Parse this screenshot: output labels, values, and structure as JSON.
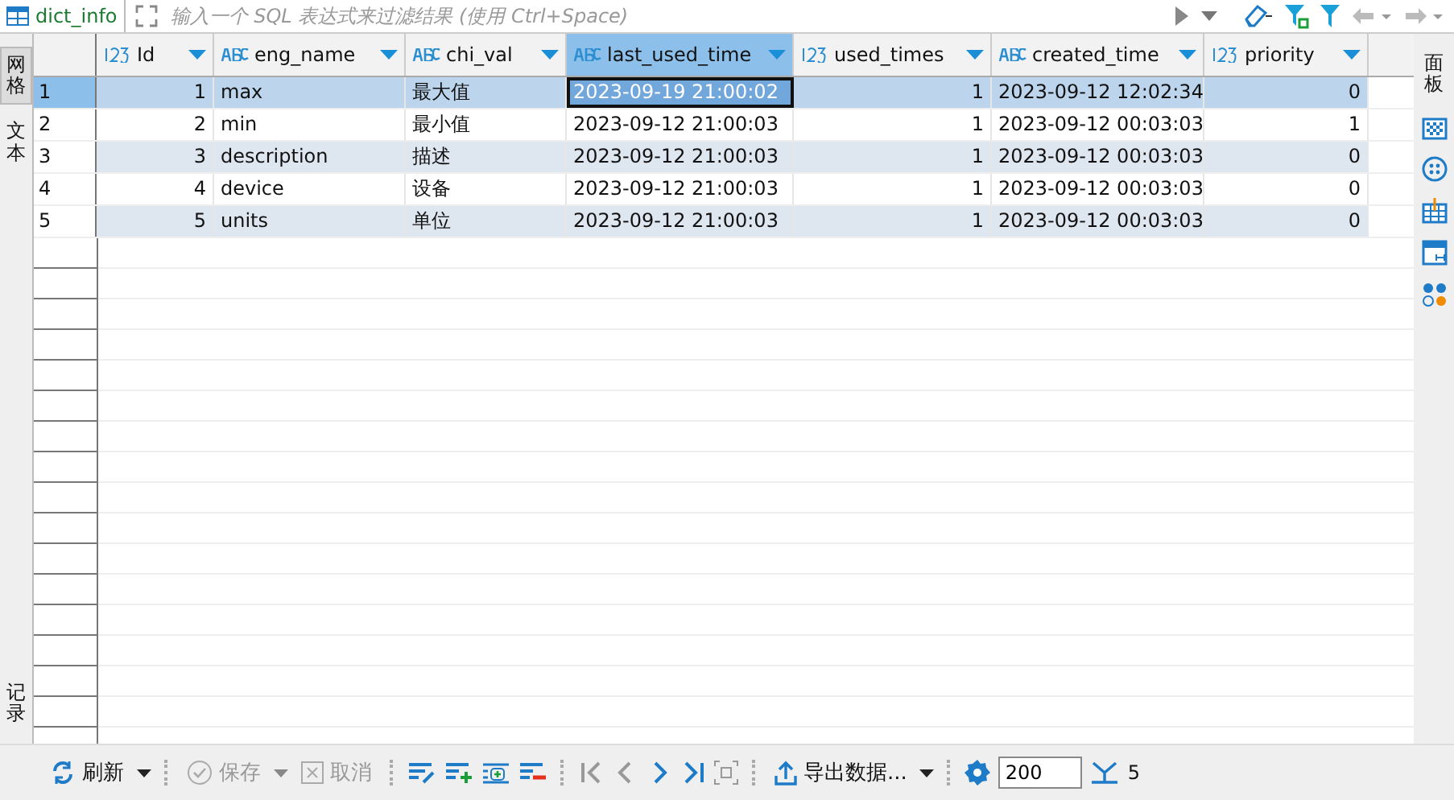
{
  "tab": {
    "title": "dict_info"
  },
  "filter": {
    "placeholder": "输入一个 SQL 表达式来过滤结果 (使用 Ctrl+Space)"
  },
  "left_panels": [
    {
      "label": "网格",
      "selected": true
    },
    {
      "label": "文本",
      "selected": false
    },
    {
      "label": "记录",
      "selected": false
    }
  ],
  "right_panels": [
    {
      "label": "面板",
      "selected": false
    }
  ],
  "table": {
    "columns": [
      {
        "name": "Id",
        "kind": "number",
        "selected": false
      },
      {
        "name": "eng_name",
        "kind": "text",
        "selected": false
      },
      {
        "name": "chi_val",
        "kind": "text",
        "selected": false
      },
      {
        "name": "last_used_time",
        "kind": "text",
        "selected": true
      },
      {
        "name": "used_times",
        "kind": "number",
        "selected": false
      },
      {
        "name": "created_time",
        "kind": "text",
        "selected": false
      },
      {
        "name": "priority",
        "kind": "number",
        "selected": false
      }
    ],
    "rows": [
      {
        "number": "1",
        "selected": true,
        "focused": true,
        "cells": [
          "1",
          "max",
          "最大值",
          "2023-09-19 21:00:02",
          "1",
          "2023-09-12 12:02:34",
          "0"
        ]
      },
      {
        "number": "2",
        "selected": false,
        "focused": false,
        "cells": [
          "2",
          "min",
          "最小值",
          "2023-09-12 21:00:03",
          "1",
          "2023-09-12 00:03:03",
          "1"
        ]
      },
      {
        "number": "3",
        "selected": false,
        "focused": false,
        "cells": [
          "3",
          "description",
          "描述",
          "2023-09-12 21:00:03",
          "1",
          "2023-09-12 00:03:03",
          "0"
        ]
      },
      {
        "number": "4",
        "selected": false,
        "focused": false,
        "cells": [
          "4",
          "device",
          "设备",
          "2023-09-12 21:00:03",
          "1",
          "2023-09-12 00:03:03",
          "0"
        ]
      },
      {
        "number": "5",
        "selected": false,
        "focused": false,
        "cells": [
          "5",
          "units",
          "单位",
          "2023-09-12 21:00:03",
          "1",
          "2023-09-12 00:03:03",
          "0"
        ]
      }
    ]
  },
  "toolbar": {
    "refresh": {
      "label": "刷新",
      "disabled": false
    },
    "save": {
      "label": "保存",
      "disabled": true
    },
    "cancel": {
      "label": "取消",
      "disabled": true
    },
    "nav": [
      {
        "kind": "first",
        "disabled": true
      },
      {
        "kind": "prev",
        "disabled": true
      },
      {
        "kind": "next",
        "disabled": false
      },
      {
        "kind": "last",
        "disabled": false
      }
    ],
    "export": {
      "label": "导出数据..."
    },
    "fetch_size": "200",
    "row_count": "5"
  }
}
